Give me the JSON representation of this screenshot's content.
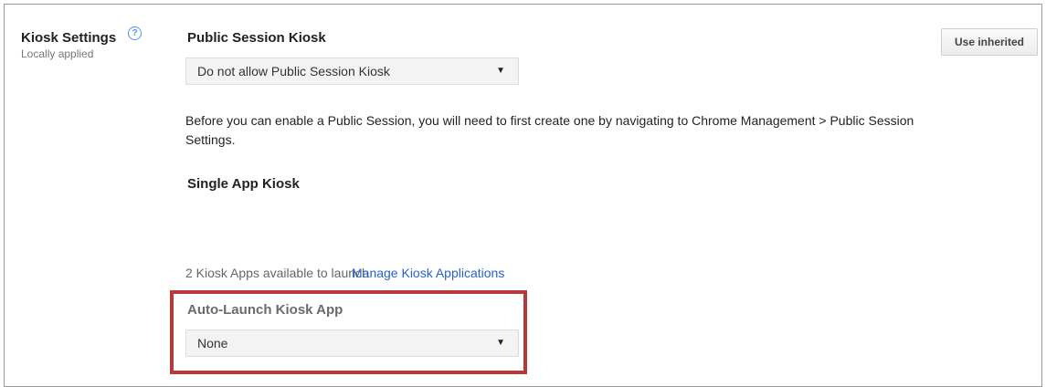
{
  "settings": {
    "title": "Kiosk Settings",
    "subtitle": "Locally applied",
    "help_icon_glyph": "?",
    "use_inherited_label": "Use inherited"
  },
  "public_session": {
    "heading": "Public Session Kiosk",
    "select_value": "Do not allow Public Session Kiosk",
    "description": "Before you can enable a Public Session, you will need to first create one by navigating to Chrome Management > Public Session Settings."
  },
  "single_app": {
    "heading": "Single App Kiosk",
    "apps_available": "2 Kiosk Apps available to launch",
    "manage_link": "Manage Kiosk Applications"
  },
  "auto_launch": {
    "heading": "Auto-Launch Kiosk App",
    "select_value": "None"
  },
  "icons": {
    "dropdown_arrow": "▼",
    "help": "help-icon"
  },
  "colors": {
    "highlight": "#b53a3a",
    "link": "#2962c6",
    "help_icon": "#4d90fe"
  }
}
